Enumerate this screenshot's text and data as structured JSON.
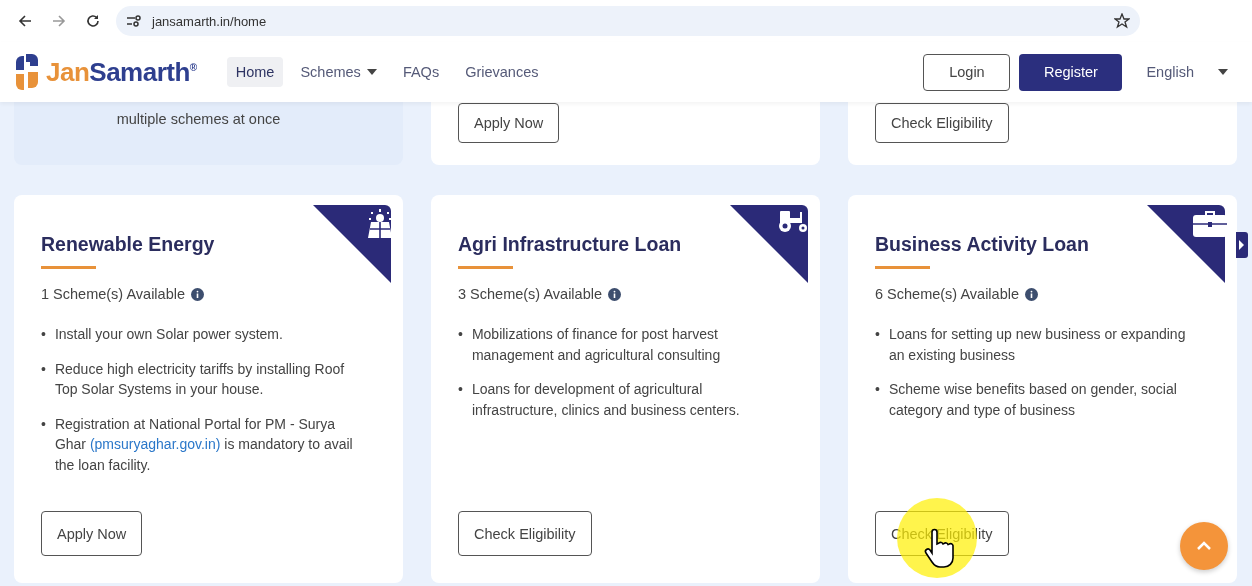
{
  "browser": {
    "url": "jansamarth.in/home"
  },
  "nav": {
    "logo": {
      "part_1": "Jan",
      "part_2": "Samarth",
      "mark": "®"
    },
    "items": [
      {
        "label": "Home",
        "selected": true,
        "dropdown": false
      },
      {
        "label": "Schemes",
        "selected": false,
        "dropdown": true
      },
      {
        "label": "FAQs",
        "selected": false,
        "dropdown": false
      },
      {
        "label": "Grievances",
        "selected": false,
        "dropdown": false
      }
    ],
    "login": "Login",
    "register": "Register",
    "language": "English"
  },
  "top_cards": [
    {
      "kind": "text",
      "text": "multiple schemes at once"
    },
    {
      "kind": "button",
      "text": "Apply Now"
    },
    {
      "kind": "button",
      "text": "Check Eligibility"
    }
  ],
  "loan_cards": [
    {
      "title": "Renewable Energy",
      "schemes": "1 Scheme(s) Available",
      "bullets": [
        {
          "marker": "•",
          "parts": [
            {
              "kind": "text",
              "text": "Install your own Solar power system."
            }
          ]
        },
        {
          "marker": "•",
          "parts": [
            {
              "kind": "text",
              "text": "Reduce high electricity tariffs by installing Roof Top Solar Systems in your house."
            }
          ]
        },
        {
          "marker": "•",
          "parts": [
            {
              "kind": "text",
              "text": "Registration at National Portal for PM - Surya Ghar "
            },
            {
              "kind": "link",
              "text": "(pmsuryaghar.gov.in)"
            },
            {
              "kind": "text",
              "text": " is mandatory to avail the loan facility."
            }
          ]
        }
      ],
      "button": "Apply Now"
    },
    {
      "title": "Agri Infrastructure Loan",
      "schemes": "3 Scheme(s) Available",
      "bullets": [
        {
          "marker": "•",
          "parts": [
            {
              "kind": "text",
              "text": "Mobilizations of finance for post harvest management and agricultural consulting"
            }
          ]
        },
        {
          "marker": "•",
          "parts": [
            {
              "kind": "text",
              "text": "Loans for development of agricultural infrastructure, clinics and business centers."
            }
          ]
        }
      ],
      "button": "Check Eligibility"
    },
    {
      "title": "Business Activity Loan",
      "schemes": "6 Scheme(s) Available",
      "bullets": [
        {
          "marker": "•",
          "parts": [
            {
              "kind": "text",
              "text": "Loans for setting up new business or expanding an existing business"
            }
          ]
        },
        {
          "marker": "•",
          "parts": [
            {
              "kind": "text",
              "text": "Scheme wise benefits based on gender, social category and type of business"
            }
          ]
        }
      ],
      "button": "Check Eligibility"
    }
  ]
}
